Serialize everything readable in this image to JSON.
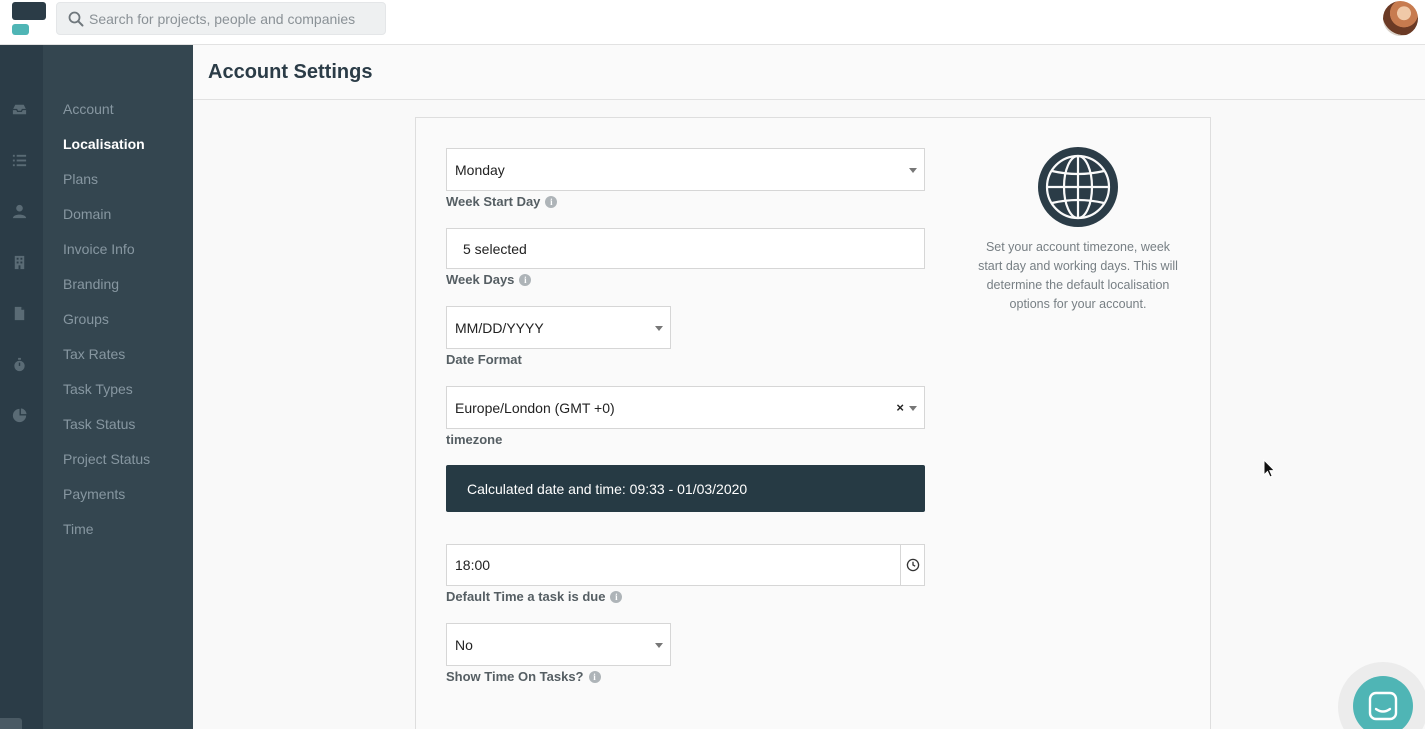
{
  "topbar": {
    "search_placeholder": "Search for projects, people and companies"
  },
  "rail_icons": [
    "inbox-icon",
    "list-icon",
    "person-icon",
    "building-icon",
    "document-icon",
    "stopwatch-icon",
    "pie-chart-icon"
  ],
  "sidenav": {
    "items": [
      {
        "label": "Account"
      },
      {
        "label": "Localisation",
        "active": true
      },
      {
        "label": "Plans"
      },
      {
        "label": "Domain"
      },
      {
        "label": "Invoice Info"
      },
      {
        "label": "Branding"
      },
      {
        "label": "Groups"
      },
      {
        "label": "Tax Rates"
      },
      {
        "label": "Task Types"
      },
      {
        "label": "Task Status"
      },
      {
        "label": "Project Status"
      },
      {
        "label": "Payments"
      },
      {
        "label": "Time"
      }
    ]
  },
  "page": {
    "title": "Account Settings"
  },
  "form": {
    "week_start_day": {
      "value": "Monday",
      "label": "Week Start Day"
    },
    "week_days": {
      "value": "5 selected",
      "label": "Week Days"
    },
    "date_format": {
      "value": "MM/DD/YYYY",
      "label": "Date Format"
    },
    "timezone": {
      "value": "Europe/London (GMT +0)",
      "label": "timezone",
      "clear": "×"
    },
    "calculated": "Calculated date and time: 09:33 - 01/03/2020",
    "default_time": {
      "value": "18:00",
      "label": "Default Time a task is due"
    },
    "show_time": {
      "value": "No",
      "label": "Show Time On Tasks?"
    }
  },
  "info_panel": {
    "icon": "globe-icon",
    "text": "Set your account timezone, week start day and working days. This will determine the default localisation options for your account."
  },
  "colors": {
    "sidebar_dark": "#2b3c47",
    "sidebar_nav": "#344650",
    "accent": "#4fb5b5",
    "calc_bar": "#263a44"
  }
}
